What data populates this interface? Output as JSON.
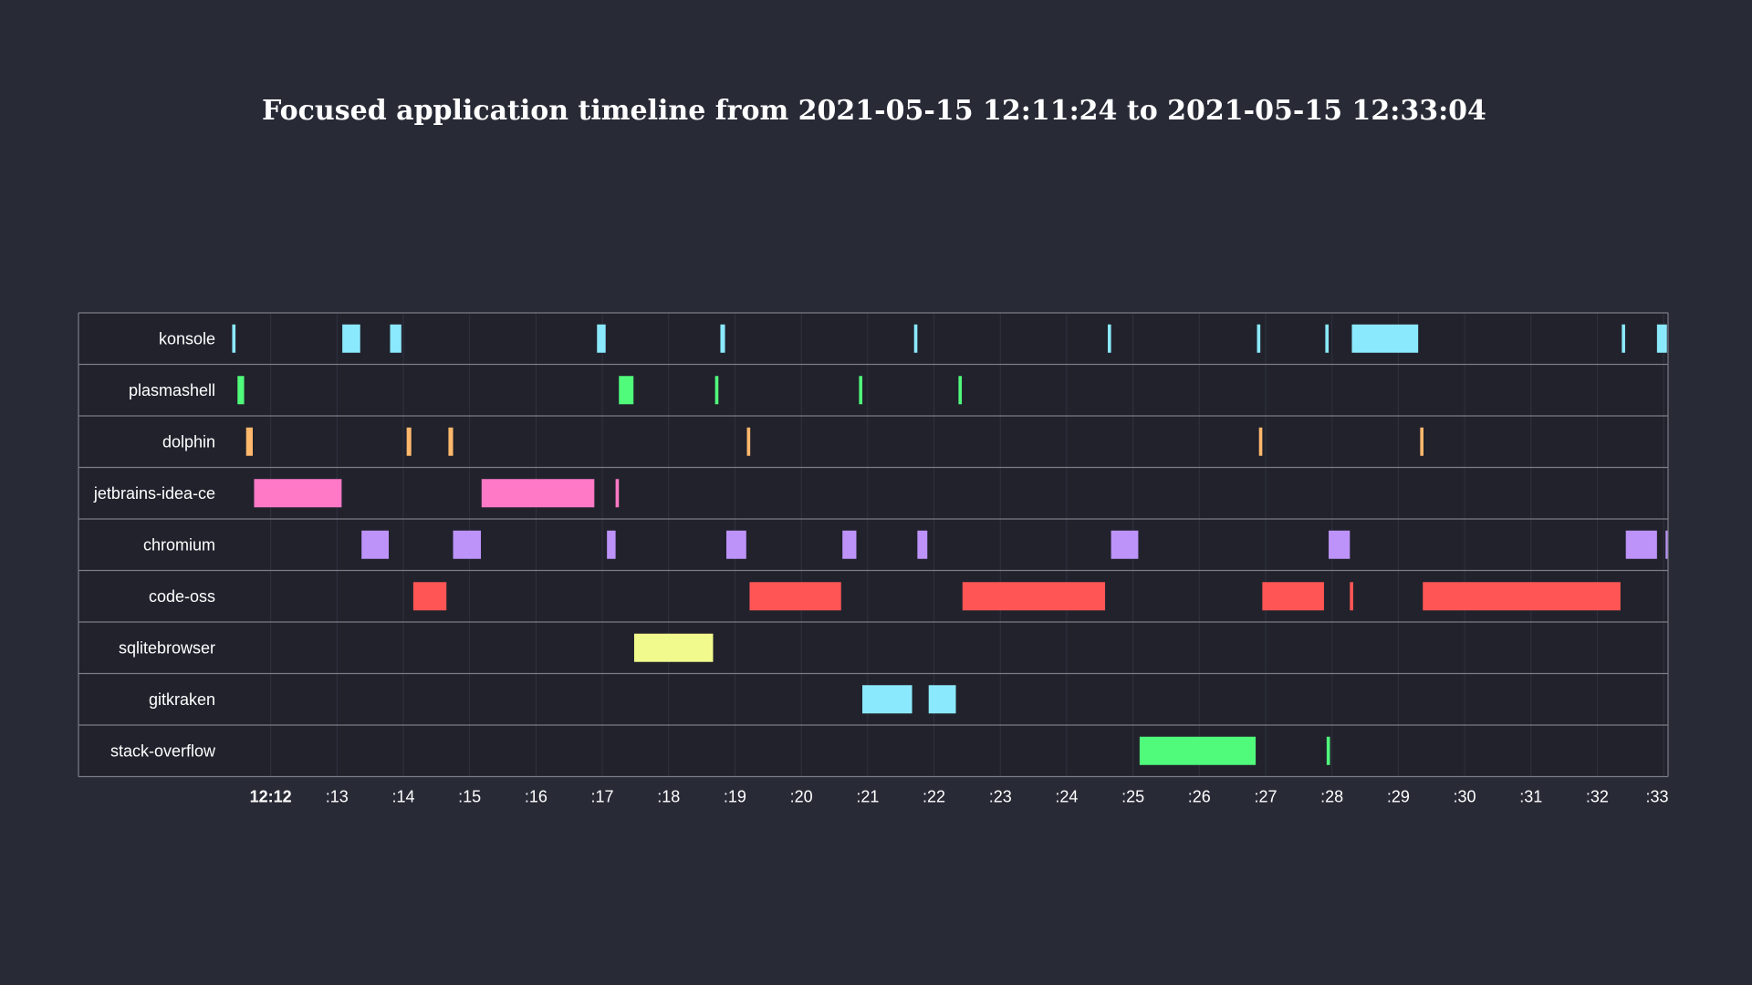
{
  "chart_data": {
    "type": "timeline",
    "title": "Focused application timeline from 2021-05-15 12:11:24 to 2021-05-15 12:33:04",
    "time_unit": "minutes after 12:00 on 2021-05-15",
    "x_range": [
      11.4,
      33.067
    ],
    "x_ticks": [
      {
        "value": 12,
        "label": "12:12",
        "bold": true
      },
      {
        "value": 13,
        "label": ":13"
      },
      {
        "value": 14,
        "label": ":14"
      },
      {
        "value": 15,
        "label": ":15"
      },
      {
        "value": 16,
        "label": ":16"
      },
      {
        "value": 17,
        "label": ":17"
      },
      {
        "value": 18,
        "label": ":18"
      },
      {
        "value": 19,
        "label": ":19"
      },
      {
        "value": 20,
        "label": ":20"
      },
      {
        "value": 21,
        "label": ":21"
      },
      {
        "value": 22,
        "label": ":22"
      },
      {
        "value": 23,
        "label": ":23"
      },
      {
        "value": 24,
        "label": ":24"
      },
      {
        "value": 25,
        "label": ":25"
      },
      {
        "value": 26,
        "label": ":26"
      },
      {
        "value": 27,
        "label": ":27"
      },
      {
        "value": 28,
        "label": ":28"
      },
      {
        "value": 29,
        "label": ":29"
      },
      {
        "value": 30,
        "label": ":30"
      },
      {
        "value": 31,
        "label": ":31"
      },
      {
        "value": 32,
        "label": ":32"
      },
      {
        "value": 33,
        "label": ":33"
      }
    ],
    "grid": true,
    "lanes": [
      {
        "name": "konsole",
        "color": "#8be9fd",
        "intervals": [
          [
            11.42,
            11.47
          ],
          [
            13.08,
            13.35
          ],
          [
            13.8,
            13.97
          ],
          [
            16.92,
            17.05
          ],
          [
            18.78,
            18.85
          ],
          [
            21.7,
            21.75
          ],
          [
            24.62,
            24.67
          ],
          [
            26.87,
            26.92
          ],
          [
            27.9,
            27.95
          ],
          [
            28.3,
            29.3
          ],
          [
            32.37,
            32.42
          ],
          [
            32.9,
            33.05
          ]
        ]
      },
      {
        "name": "plasmashell",
        "color": "#50fa7b",
        "intervals": [
          [
            11.5,
            11.6
          ],
          [
            17.25,
            17.47
          ],
          [
            18.7,
            18.75
          ],
          [
            20.87,
            20.92
          ],
          [
            22.37,
            22.42
          ]
        ]
      },
      {
        "name": "dolphin",
        "color": "#ffb86c",
        "intervals": [
          [
            11.63,
            11.73
          ],
          [
            14.05,
            14.12
          ],
          [
            14.68,
            14.75
          ],
          [
            19.18,
            19.23
          ],
          [
            26.9,
            26.95
          ],
          [
            29.33,
            29.38
          ]
        ]
      },
      {
        "name": "jetbrains-idea-ce",
        "color": "#ff79c6",
        "intervals": [
          [
            11.75,
            13.07
          ],
          [
            15.18,
            16.88
          ],
          [
            17.2,
            17.25
          ]
        ]
      },
      {
        "name": "chromium",
        "color": "#bd93f9",
        "intervals": [
          [
            13.37,
            13.78
          ],
          [
            14.75,
            15.17
          ],
          [
            17.07,
            17.2
          ],
          [
            18.87,
            19.17
          ],
          [
            20.62,
            20.83
          ],
          [
            21.75,
            21.9
          ],
          [
            24.67,
            25.08
          ],
          [
            27.95,
            28.27
          ],
          [
            32.43,
            32.9
          ],
          [
            33.03,
            33.07
          ]
        ]
      },
      {
        "name": "code-oss",
        "color": "#ff5555",
        "intervals": [
          [
            14.15,
            14.65
          ],
          [
            19.22,
            20.6
          ],
          [
            22.43,
            24.58
          ],
          [
            26.95,
            27.88
          ],
          [
            28.27,
            28.32
          ],
          [
            29.37,
            32.35
          ]
        ]
      },
      {
        "name": "sqlitebrowser",
        "color": "#f1fa8c",
        "intervals": [
          [
            17.48,
            18.67
          ]
        ]
      },
      {
        "name": "gitkraken",
        "color": "#8be9fd",
        "intervals": [
          [
            20.92,
            21.67
          ],
          [
            21.92,
            22.33
          ]
        ]
      },
      {
        "name": "stack-overflow",
        "color": "#50fa7b",
        "intervals": [
          [
            25.1,
            26.85
          ],
          [
            27.92,
            27.97
          ]
        ]
      }
    ]
  }
}
